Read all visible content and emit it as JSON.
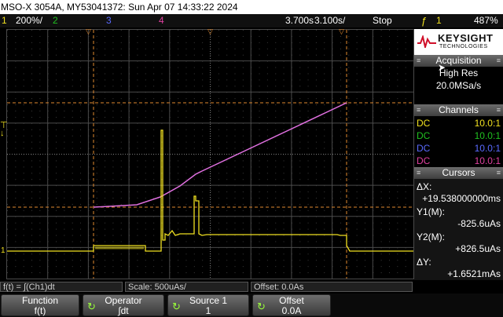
{
  "title_bar": {
    "text": "MSO-X 3054A, MY53041372: Sun Apr 07 14:33:22 2024"
  },
  "status_bar": {
    "ch1_num": "1",
    "ch1_scale": "200%/",
    "ch2_num": "2",
    "ch3_num": "3",
    "ch4_num": "4",
    "time_offset": "3.700s",
    "time_scale": "3.100s/",
    "run_state": "Stop",
    "trig_src": "1",
    "trig_level": "487%",
    "colors": {
      "ch1": "#f0e020",
      "ch2": "#20c020",
      "ch3": "#5a6aff",
      "ch4": "#e040a0",
      "math": "#e070e0"
    }
  },
  "brand": {
    "line1": "KEYSIGHT",
    "line2": "TECHNOLOGIES"
  },
  "acquisition": {
    "header": "Acquisition",
    "mode": "High Res",
    "rate": "20.0MSa/s"
  },
  "channels": {
    "header": "Channels",
    "rows": [
      {
        "coupling": "DC",
        "probe": "10.0:1",
        "color": "#f0e020"
      },
      {
        "coupling": "DC",
        "probe": "10.0:1",
        "color": "#20c020"
      },
      {
        "coupling": "DC",
        "probe": "10.0:1",
        "color": "#5a6aff"
      },
      {
        "coupling": "DC",
        "probe": "10.0:1",
        "color": "#e040a0"
      }
    ]
  },
  "cursors": {
    "header": "Cursors",
    "dx_label": "ΔX:",
    "dx_value": "+19.538000000ms",
    "y1_label": "Y1(M):",
    "y1_value": "-825.6uAs",
    "y2_label": "Y2(M):",
    "y2_value": "+826.5uAs",
    "dy_label": "ΔY:",
    "dy_value": "+1.6521mAs"
  },
  "measure_bar": {
    "function": "f(t) = ∫(Ch1)dt",
    "scale": "Scale: 500uAs/",
    "offset": "Offset: 0.0As"
  },
  "softkeys": [
    {
      "label": "Function",
      "value": "f(t)"
    },
    {
      "label": "Operator",
      "value": "∫dt"
    },
    {
      "label": "Source 1",
      "value": "1"
    },
    {
      "label": "Offset",
      "value": "0.0A"
    }
  ]
}
